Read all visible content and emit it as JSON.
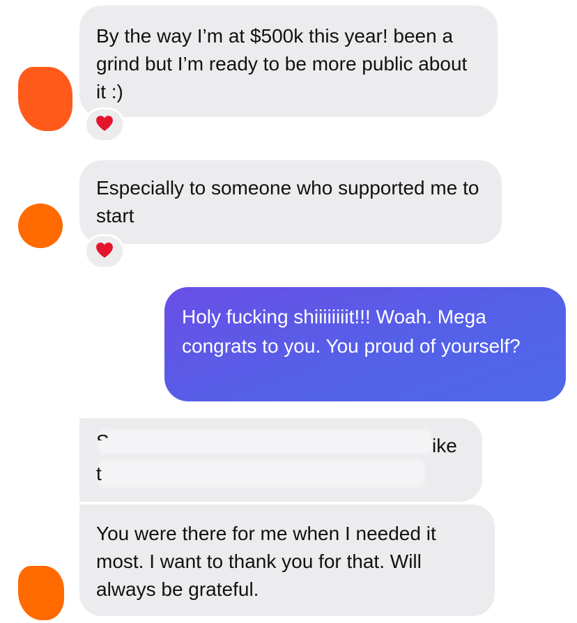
{
  "conversation": {
    "messages": [
      {
        "id": "m1",
        "direction": "incoming",
        "text": "By the way I’m at $500k this year! been a grind but I’m ready to be more public about it :)",
        "reaction": "heart"
      },
      {
        "id": "m2",
        "direction": "incoming",
        "text": "Especially to someone who supported me to start",
        "reaction": "heart"
      },
      {
        "id": "m3",
        "direction": "outgoing",
        "text": "Holy fucking shiiiiiiiit!!! Woah. Mega congrats to you. You proud of yourself?"
      },
      {
        "id": "m4",
        "direction": "incoming",
        "redacted": true,
        "visible_fragments": [
          "S",
          "ike",
          "t"
        ]
      },
      {
        "id": "m5",
        "direction": "incoming",
        "text": "You were there for me when I needed it most. I want to thank you for that. Will always be grateful."
      }
    ]
  },
  "icons": {
    "reaction": "heart-icon"
  },
  "colors": {
    "incoming_bubble": "#ececee",
    "outgoing_bubble": "#5a5ce8",
    "heart": "#e4152b",
    "avatar_redaction": "#ff6a00"
  }
}
